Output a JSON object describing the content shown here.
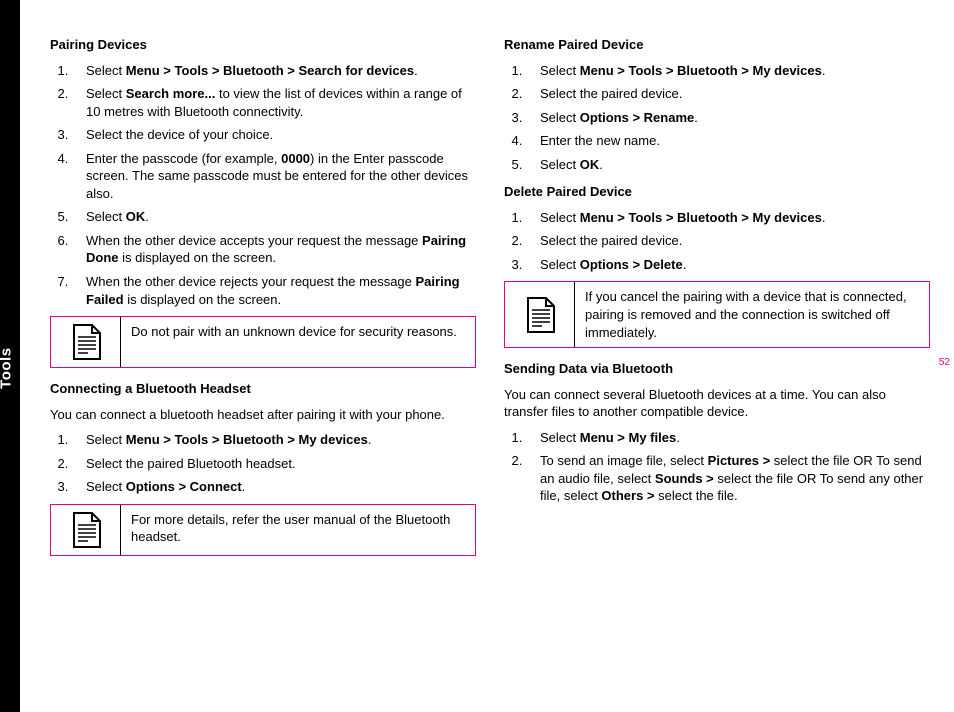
{
  "sidebar": {
    "label": "Tools"
  },
  "page_number": "52",
  "left": {
    "h1": "Pairing Devices",
    "steps1": [
      {
        "pre": "Select ",
        "bold": "Menu > Tools > Bluetooth > Search for devices",
        "post": "."
      },
      {
        "pre": "Select ",
        "bold": "Search more...",
        "post": " to view the list of devices within a range of 10 metres with Bluetooth connectivity."
      },
      {
        "pre": "Select the device of your choice.",
        "bold": "",
        "post": ""
      },
      {
        "pre": "Enter the passcode (for example, ",
        "bold": "0000",
        "post": ") in the Enter passcode screen. The same passcode must be entered for the other devices also."
      },
      {
        "pre": "Select ",
        "bold": "OK",
        "post": "."
      },
      {
        "pre": "When the other device accepts your request the message ",
        "bold": "Pairing Done",
        "post": " is displayed on the screen."
      },
      {
        "pre": "When the other device rejects your request the message ",
        "bold": "Pairing Failed",
        "post": " is displayed on the screen."
      }
    ],
    "note1": "Do not pair with an unknown device for security reasons.",
    "h2": "Connecting a Bluetooth Headset",
    "p2": "You can connect a bluetooth headset after pairing it with your phone.",
    "steps2": [
      {
        "pre": "Select ",
        "bold": "Menu > Tools > Bluetooth > My devices",
        "post": "."
      },
      {
        "pre": "Select the paired Bluetooth headset.",
        "bold": "",
        "post": ""
      },
      {
        "pre": "Select ",
        "bold": "Options > Connect",
        "post": "."
      }
    ],
    "note2": "For more details, refer the user manual of the Bluetooth headset."
  },
  "right": {
    "h1": "Rename Paired Device",
    "steps1": [
      {
        "pre": "Select ",
        "bold": "Menu > Tools > Bluetooth > My devices",
        "post": "."
      },
      {
        "pre": "Select the paired device.",
        "bold": "",
        "post": ""
      },
      {
        "pre": "Select ",
        "bold": "Options > Rename",
        "post": "."
      },
      {
        "pre": "Enter the new name.",
        "bold": "",
        "post": ""
      },
      {
        "pre": "Select ",
        "bold": "OK",
        "post": "."
      }
    ],
    "h2": "Delete Paired Device",
    "steps2": [
      {
        "pre": "Select ",
        "bold": "Menu > Tools > Bluetooth > My devices",
        "post": "."
      },
      {
        "pre": "Select the paired device.",
        "bold": "",
        "post": ""
      },
      {
        "pre": "Select ",
        "bold": "Options > Delete",
        "post": "."
      }
    ],
    "note1": "If you cancel the pairing with a device that is connected, pairing is removed and the connection is switched off immediately.",
    "h3": "Sending Data via Bluetooth",
    "p3": "You can connect several Bluetooth devices at a time. You can also transfer files to another compatible device.",
    "steps3": [
      {
        "pre": "Select ",
        "bold": "Menu > My files",
        "post": "."
      },
      {
        "parts": [
          {
            "t": "To send an image file, select "
          },
          {
            "b": "Pictures > "
          },
          {
            "t": "select the file OR To send an audio file, select "
          },
          {
            "b": "Sounds > "
          },
          {
            "t": "select the file OR To send any other file, select "
          },
          {
            "b": "Others > "
          },
          {
            "t": "select the file."
          }
        ]
      }
    ]
  }
}
